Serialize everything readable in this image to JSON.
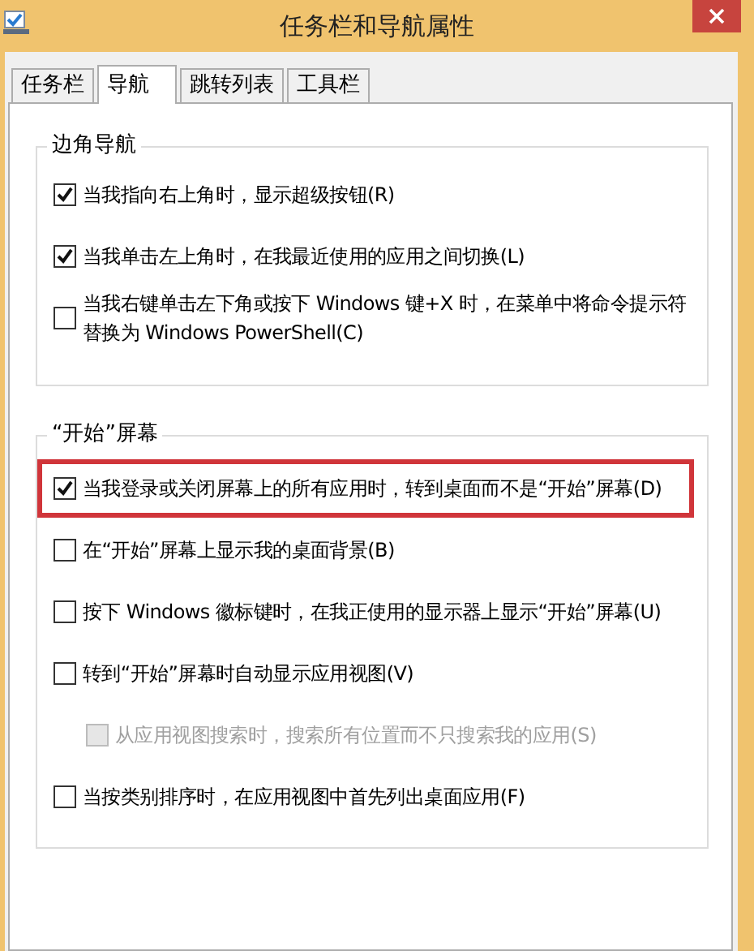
{
  "window": {
    "title": "任务栏和导航属性"
  },
  "tabs": [
    {
      "label": "任务栏",
      "selected": false
    },
    {
      "label": "导航",
      "selected": true
    },
    {
      "label": "跳转列表",
      "selected": false
    },
    {
      "label": "工具栏",
      "selected": false
    }
  ],
  "groups": [
    {
      "title": "边角导航",
      "options": [
        {
          "label": "当我指向右上角时，显示超级按钮(R)",
          "checked": true,
          "disabled": false,
          "indented": false,
          "highlighted": false
        },
        {
          "label": "当我单击左上角时，在我最近使用的应用之间切换(L)",
          "checked": true,
          "disabled": false,
          "indented": false,
          "highlighted": false
        },
        {
          "label": "当我右键单击左下角或按下 Windows 键+X 时，在菜单中将命令提示符替换为 Windows PowerShell(C)",
          "checked": false,
          "disabled": false,
          "indented": false,
          "highlighted": false
        }
      ]
    },
    {
      "title": "“开始”屏幕",
      "options": [
        {
          "label": "当我登录或关闭屏幕上的所有应用时，转到桌面而不是“开始”屏幕(D)",
          "checked": true,
          "disabled": false,
          "indented": false,
          "highlighted": true
        },
        {
          "label": "在“开始”屏幕上显示我的桌面背景(B)",
          "checked": false,
          "disabled": false,
          "indented": false,
          "highlighted": false
        },
        {
          "label": "按下 Windows 徽标键时，在我正使用的显示器上显示“开始”屏幕(U)",
          "checked": false,
          "disabled": false,
          "indented": false,
          "highlighted": false
        },
        {
          "label": "转到“开始”屏幕时自动显示应用视图(V)",
          "checked": false,
          "disabled": false,
          "indented": false,
          "highlighted": false
        },
        {
          "label": "从应用视图搜索时，搜索所有位置而不只搜索我的应用(S)",
          "checked": false,
          "disabled": true,
          "indented": true,
          "highlighted": false
        },
        {
          "label": "当按类别排序时，在应用视图中首先列出桌面应用(F)",
          "checked": false,
          "disabled": false,
          "indented": false,
          "highlighted": false
        }
      ]
    }
  ]
}
